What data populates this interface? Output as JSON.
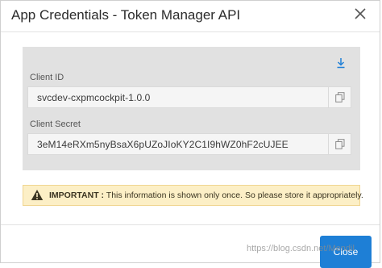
{
  "dialog": {
    "title": "App Credentials - Token Manager API"
  },
  "credentials": {
    "client_id_label": "Client ID",
    "client_id_value": "svcdev-cxpmcockpit-1.0.0",
    "client_secret_label": "Client Secret",
    "client_secret_value": "3eM14eRXm5nyBsaX6pUZoJIoKY2C1I9hWZ0hF2cUJEE"
  },
  "alert": {
    "strong": "IMPORTANT :",
    "message": " This information is shown only once. So please store it appropriately."
  },
  "footer": {
    "close_label": "Close"
  },
  "watermark": "https://blog.csdn.net/Mendil",
  "icons": {
    "close": "close-icon",
    "download": "download-icon",
    "copy": "copy-icon",
    "warning": "warning-icon"
  },
  "colors": {
    "primary_button": "#1e7fd6",
    "download_icon": "#1e7fd6",
    "panel_background": "#e1e1e1",
    "alert_background": "#fcefc6"
  }
}
